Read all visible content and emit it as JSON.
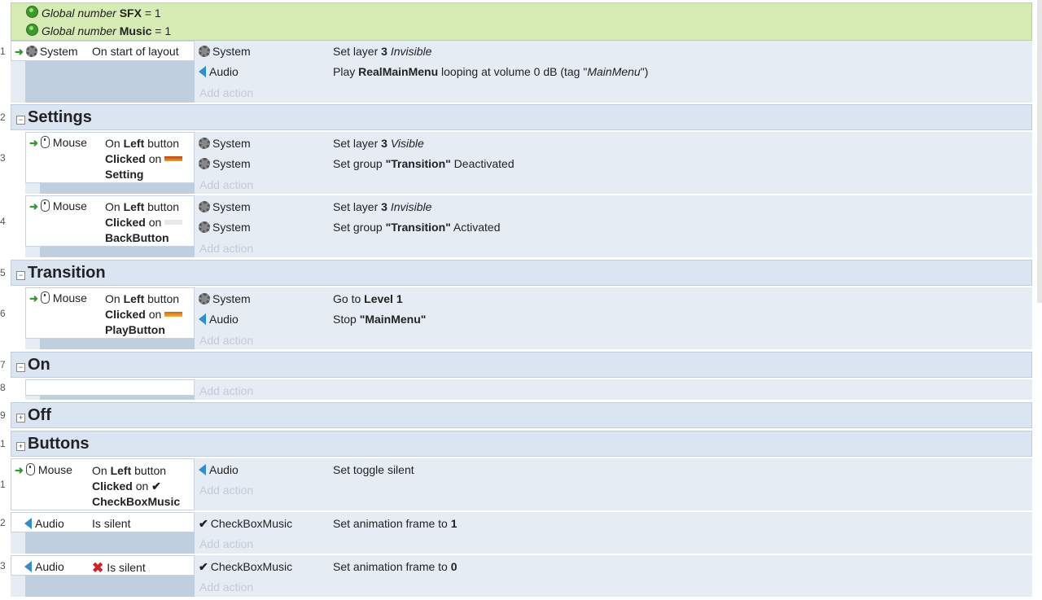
{
  "globals": [
    {
      "prefix": "Global number",
      "name": "SFX",
      "value": "= 1"
    },
    {
      "prefix": "Global number",
      "name": "Music",
      "value": "= 1"
    }
  ],
  "line_numbers": {
    "e1": "1",
    "g2": "2",
    "e3": "3",
    "e4": "4",
    "g5": "5",
    "e6": "6",
    "g7": "7",
    "e8": "8",
    "g9": "9",
    "g10": "1",
    "e11": "1",
    "e12": "2",
    "e13": "3"
  },
  "add_action_label": "Add action",
  "objects": {
    "system": "System",
    "audio": "Audio",
    "mouse": "Mouse",
    "checkbox": "CheckBoxMusic"
  },
  "groups": {
    "settings": "Settings",
    "transition": "Transition",
    "on": "On",
    "off": "Off",
    "buttons": "Buttons"
  },
  "event1": {
    "cond": "On start of layout",
    "a1": {
      "pre": "Set layer ",
      "b": "3",
      "post": " ",
      "it": "Invisible"
    },
    "a2": {
      "pre": "Play ",
      "b": "RealMainMenu",
      "post": " looping at volume 0 dB (tag \"",
      "it": "MainMenu",
      "end": "\")"
    }
  },
  "click_cond": {
    "on": "On ",
    "left": "Left",
    "button": " button",
    "clicked": "Clicked",
    "on2": " on"
  },
  "event3": {
    "target": "Setting",
    "a1": {
      "pre": "Set layer ",
      "b": "3",
      "post": " ",
      "it": "Visible"
    },
    "a2": {
      "pre": "Set group ",
      "b": "\"Transition\"",
      "post": " Deactivated"
    }
  },
  "event4": {
    "target": "BackButton",
    "a1": {
      "pre": "Set layer ",
      "b": "3",
      "post": " ",
      "it": "Invisible"
    },
    "a2": {
      "pre": "Set group ",
      "b": "\"Transition\"",
      "post": " Activated"
    }
  },
  "event6": {
    "target": "PlayButton",
    "a1": {
      "pre": "Go to ",
      "b": "Level 1"
    },
    "a2": {
      "pre": "Stop ",
      "b": "\"MainMenu\""
    }
  },
  "event11": {
    "target": "CheckBoxMusic",
    "a1": "Set toggle silent"
  },
  "event12": {
    "cond": "Is silent",
    "a1": {
      "pre": "Set animation frame to ",
      "b": "1"
    }
  },
  "event13": {
    "cond": "Is silent",
    "a1": {
      "pre": "Set animation frame to ",
      "b": "0"
    }
  },
  "colors": {
    "global_bg": "#d6ecb4",
    "event_bg": "#e6ecf4",
    "group_bg": "#dbe5f1",
    "condition_column": "#c0cfe0"
  }
}
